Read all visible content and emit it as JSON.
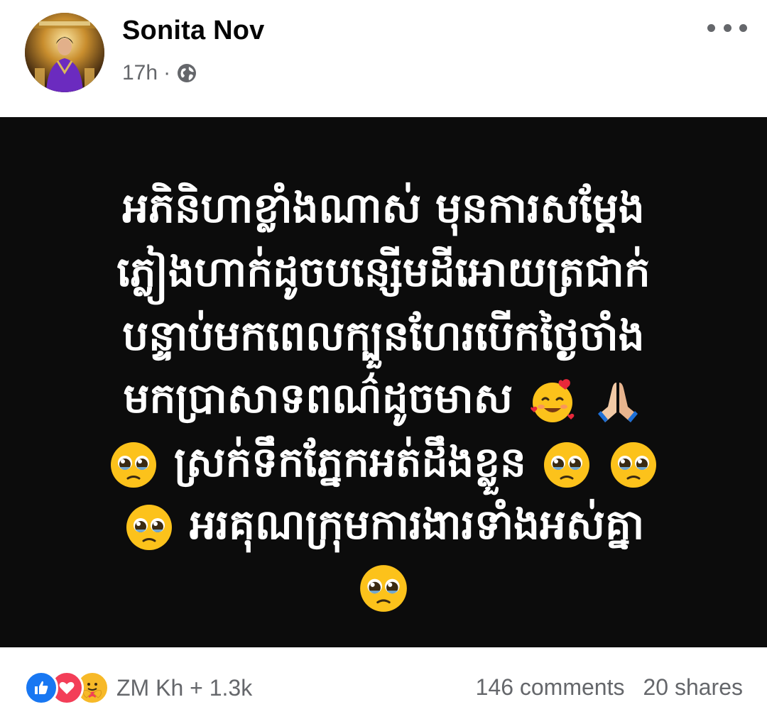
{
  "post": {
    "author": "Sonita Nov",
    "time": "17h",
    "separator": "·",
    "privacy_icon": "globe-icon",
    "more_icon": "more-options-icon"
  },
  "content": {
    "background_color": "#0c0c0c",
    "text_color": "#ffffff",
    "lines": [
      "អភិនិហាខ្លាំងណាស់ មុនការសម្តែង",
      "ភ្លៀងហាក់ដូចបន្សើមដីអោយត្រជាក់",
      "បន្ទាប់មកពេលក្បួនហែរបើកថ្ងៃចាំង",
      "មកប្រាសាទពណ៌ដូចមាស",
      "ស្រក់ទឹកភ្នែកអត់ដឹងខ្លួន",
      "អរគុណក្រុមការងារទាំងអស់គ្នា"
    ],
    "emojis": {
      "line4": [
        "smiling-face-with-hearts",
        "folded-hands"
      ],
      "line5_before": "pleading-face",
      "line5_after": [
        "pleading-face",
        "pleading-face"
      ],
      "line6_before": "pleading-face",
      "line7": "pleading-face"
    }
  },
  "footer": {
    "reactions": [
      "like-icon",
      "love-icon",
      "care-icon"
    ],
    "reaction_summary": "ZM Kh + 1.3k",
    "comments": "146 comments",
    "shares": "20 shares"
  },
  "colors": {
    "like": "#1877f2",
    "love": "#f33e58",
    "care": "#f7b928",
    "secondary_text": "#65676b"
  }
}
